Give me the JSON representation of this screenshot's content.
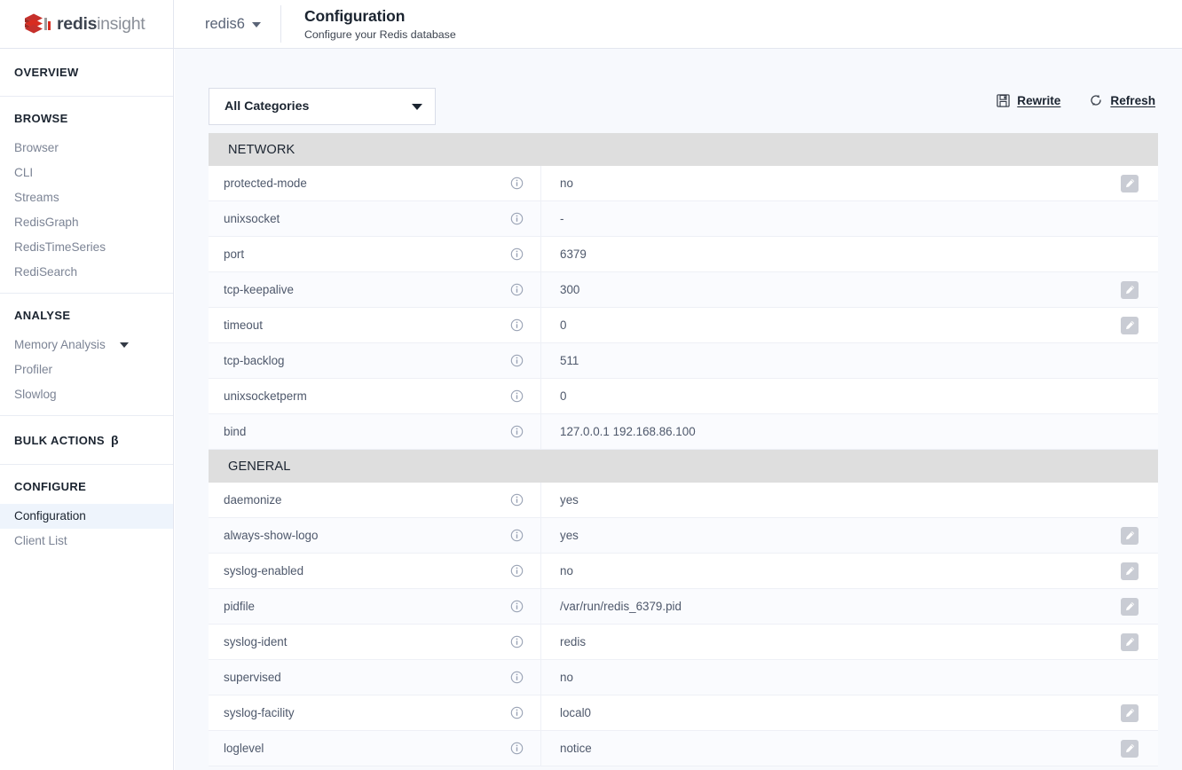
{
  "brand": {
    "bold": "redis",
    "light": "insight",
    "logo_icon": "redis-logo-icon"
  },
  "header": {
    "database": "redis6",
    "db_caret_icon": "chevron-down-icon",
    "title": "Configuration",
    "subtitle": "Configure your Redis database"
  },
  "sidebar": {
    "groups": [
      {
        "heading": "OVERVIEW",
        "solo": true,
        "items": []
      },
      {
        "heading": "BROWSE",
        "items": [
          {
            "label": "Browser",
            "selected": false
          },
          {
            "label": "CLI",
            "selected": false
          },
          {
            "label": "Streams",
            "selected": false
          },
          {
            "label": "RedisGraph",
            "selected": false
          },
          {
            "label": "RedisTimeSeries",
            "selected": false
          },
          {
            "label": "RediSearch",
            "selected": false
          }
        ]
      },
      {
        "heading": "ANALYSE",
        "items": [
          {
            "label": "Memory Analysis",
            "selected": false,
            "caret": true
          },
          {
            "label": "Profiler",
            "selected": false
          },
          {
            "label": "Slowlog",
            "selected": false
          }
        ]
      },
      {
        "heading": "BULK ACTIONS",
        "badge": "β",
        "solo": true,
        "items": []
      },
      {
        "heading": "CONFIGURE",
        "items": [
          {
            "label": "Configuration",
            "selected": true
          },
          {
            "label": "Client List",
            "selected": false
          }
        ]
      }
    ]
  },
  "toolbar": {
    "category_value": "All Categories",
    "category_caret_icon": "chevron-down-icon",
    "rewrite_label": "Rewrite",
    "rewrite_icon": "save-icon",
    "refresh_label": "Refresh",
    "refresh_icon": "refresh-icon"
  },
  "table": {
    "info_icon": "info-icon",
    "edit_icon": "edit-pencil-icon",
    "sections": [
      {
        "title": "NETWORK",
        "rows": [
          {
            "name": "protected-mode",
            "value": "no",
            "editable": true
          },
          {
            "name": "unixsocket",
            "value": "-",
            "editable": false
          },
          {
            "name": "port",
            "value": "6379",
            "editable": false
          },
          {
            "name": "tcp-keepalive",
            "value": "300",
            "editable": true
          },
          {
            "name": "timeout",
            "value": "0",
            "editable": true
          },
          {
            "name": "tcp-backlog",
            "value": "511",
            "editable": false
          },
          {
            "name": "unixsocketperm",
            "value": "0",
            "editable": false
          },
          {
            "name": "bind",
            "value": "127.0.0.1 192.168.86.100",
            "editable": false
          }
        ]
      },
      {
        "title": "GENERAL",
        "rows": [
          {
            "name": "daemonize",
            "value": "yes",
            "editable": false
          },
          {
            "name": "always-show-logo",
            "value": "yes",
            "editable": true
          },
          {
            "name": "syslog-enabled",
            "value": "no",
            "editable": true
          },
          {
            "name": "pidfile",
            "value": "/var/run/redis_6379.pid",
            "editable": true
          },
          {
            "name": "syslog-ident",
            "value": "redis",
            "editable": true
          },
          {
            "name": "supervised",
            "value": "no",
            "editable": false
          },
          {
            "name": "syslog-facility",
            "value": "local0",
            "editable": true
          },
          {
            "name": "loglevel",
            "value": "notice",
            "editable": true
          }
        ]
      }
    ]
  }
}
